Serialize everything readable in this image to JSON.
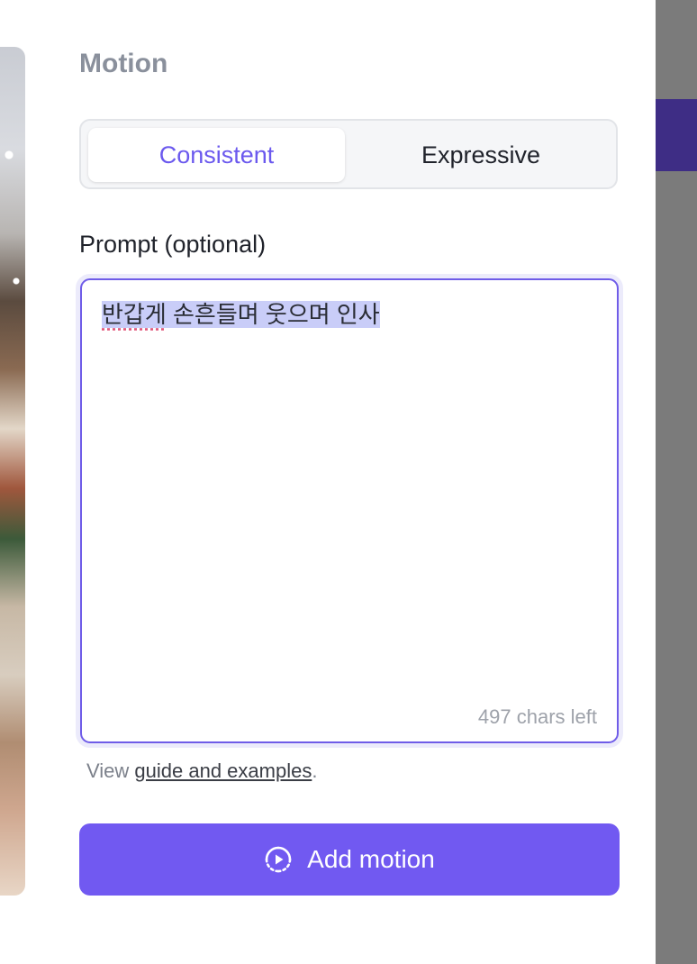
{
  "motion": {
    "title": "Motion",
    "options": [
      "Consistent",
      "Expressive"
    ],
    "selected": "Consistent"
  },
  "prompt": {
    "label": "Prompt (optional)",
    "text_first_word": "반갑게",
    "text_rest": " 손흔들며 웃으며 인사",
    "chars_left": "497 chars left"
  },
  "guide": {
    "prefix": "View ",
    "link": "guide and examples",
    "suffix": "."
  },
  "actions": {
    "add_motion_label": "Add motion",
    "add_motion_icon": "play-circle-icon"
  },
  "colors": {
    "accent": "#7159f1",
    "selected_text": "#6b59ee"
  }
}
